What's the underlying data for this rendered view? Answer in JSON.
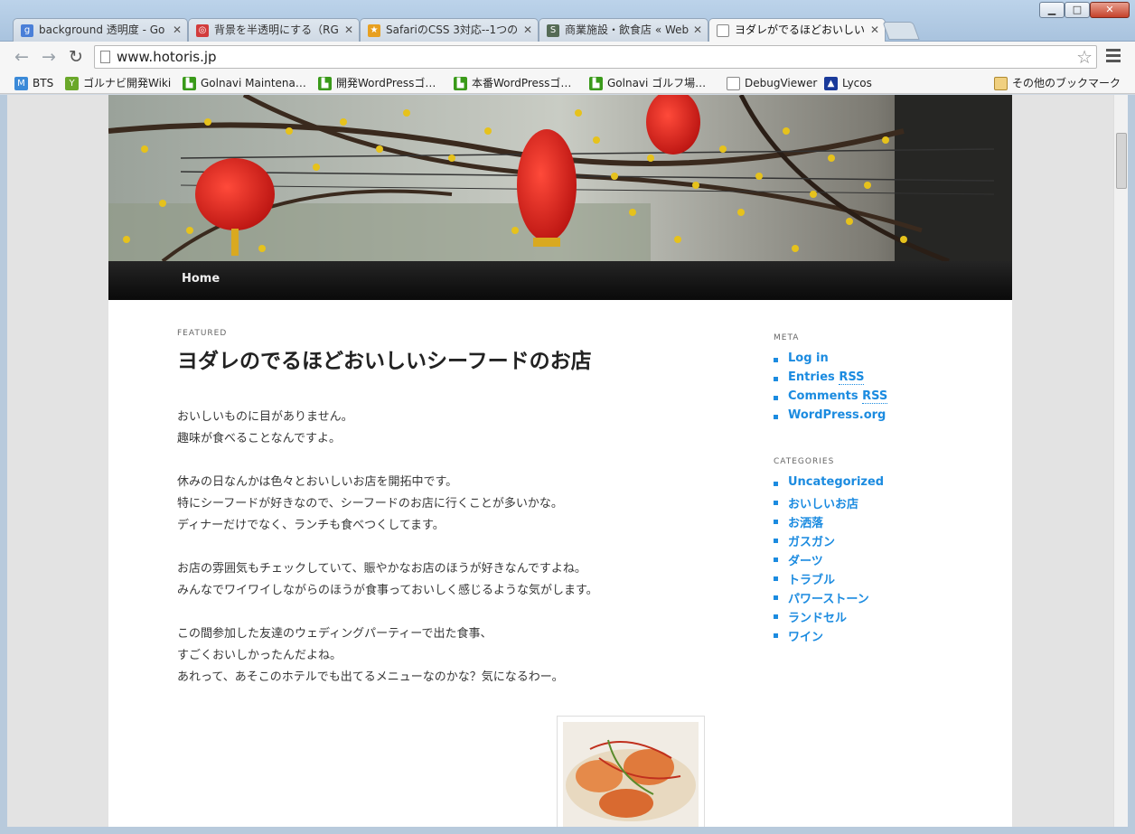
{
  "browser": {
    "tabs": [
      {
        "title": "background 透明度 - Go",
        "icon": "google-icon",
        "color": "#4a7fd8",
        "glyph": "g"
      },
      {
        "title": "背景を半透明にする（RG",
        "icon": "ring-icon",
        "color": "#d23c3c",
        "glyph": "◎"
      },
      {
        "title": "SafariのCSS 3対応--1つの",
        "icon": "star-icon",
        "color": "#e8a020",
        "glyph": "★"
      },
      {
        "title": "商業施設・飲食店 « Web",
        "icon": "s-icon",
        "color": "#556b55",
        "glyph": "S"
      },
      {
        "title": "ヨダレがでるほどおいしい",
        "icon": "page-icon",
        "color": "#ffffff",
        "glyph": ""
      }
    ],
    "url": "www.hotoris.jp",
    "bookmarks": [
      {
        "label": "BTS",
        "icon": "m-icon",
        "color": "#3b8ad8",
        "glyph": "M"
      },
      {
        "label": "ゴルナビ開発Wiki",
        "icon": "plant-icon",
        "color": "#6aa82a",
        "glyph": "Y"
      },
      {
        "label": "Golnavi Maintena…",
        "icon": "green-icon",
        "color": "#3a9a1a",
        "glyph": "▙"
      },
      {
        "label": "開発WordPressゴ…",
        "icon": "green-icon",
        "color": "#3a9a1a",
        "glyph": "▙"
      },
      {
        "label": "本番WordPressゴ…",
        "icon": "green-icon",
        "color": "#3a9a1a",
        "glyph": "▙"
      },
      {
        "label": "Golnavi ゴルフ場…",
        "icon": "green-icon",
        "color": "#3a9a1a",
        "glyph": "▙"
      },
      {
        "label": "DebugViewer",
        "icon": "page-icon",
        "color": "#ffffff",
        "glyph": ""
      },
      {
        "label": "Lycos",
        "icon": "dog-icon",
        "color": "#1a3a9a",
        "glyph": "▲"
      }
    ],
    "other_bookmarks": "その他のブックマーク"
  },
  "site": {
    "nav_home": "Home",
    "featured": "FEATURED",
    "post_title": "ヨダレのでるほどおいしいシーフードのお店",
    "paragraphs": [
      [
        "おいしいものに目がありません。",
        "趣味が食べることなんですよ。"
      ],
      [
        "休みの日なんかは色々とおいしいお店を開拓中です。",
        "特にシーフードが好きなので、シーフードのお店に行くことが多いかな。",
        "ディナーだけでなく、ランチも食べつくしてます。"
      ],
      [
        "お店の雰囲気もチェックしていて、賑やかなお店のほうが好きなんですよね。",
        "みんなでワイワイしながらのほうが食事っておいしく感じるような気がします。"
      ],
      [
        "この間参加した友達のウェディングパーティーで出た食事、",
        "すごくおいしかったんだよね。",
        "あれって、あそこのホテルでも出てるメニューなのかな？気になるわー。"
      ]
    ],
    "meta_title": "META",
    "meta_links": [
      "Log in",
      "Entries RSS",
      "Comments RSS",
      "WordPress.org"
    ],
    "categories_title": "CATEGORIES",
    "categories": [
      "Uncategorized",
      "おいしいお店",
      "お洒落",
      "ガスガン",
      "ダーツ",
      "トラブル",
      "パワーストーン",
      "ランドセル",
      "ワイン"
    ]
  }
}
